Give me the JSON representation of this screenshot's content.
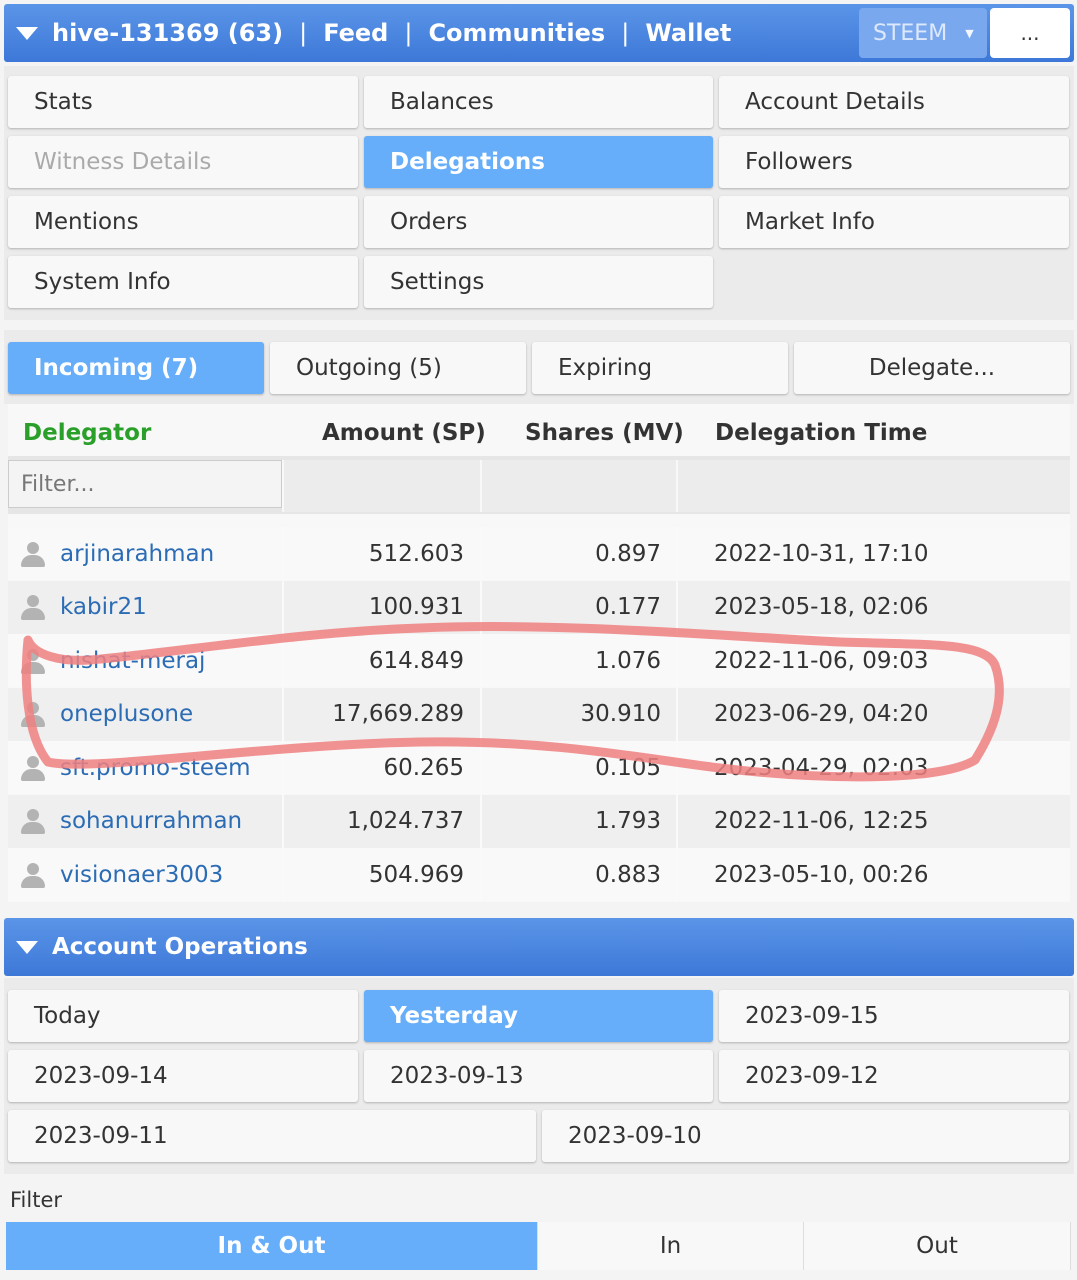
{
  "header": {
    "account": "hive-131369 (63)",
    "sep": "|",
    "links": [
      "Feed",
      "Communities",
      "Wallet"
    ],
    "chain_select": "STEEM",
    "more": "..."
  },
  "nav": {
    "items": [
      "Stats",
      "Balances",
      "Account Details",
      "Witness Details",
      "Delegations",
      "Followers",
      "Mentions",
      "Orders",
      "Market Info",
      "System Info",
      "Settings"
    ]
  },
  "tabs": [
    "Incoming (7)",
    "Outgoing (5)",
    "Expiring",
    "Delegate..."
  ],
  "table": {
    "headers": [
      "Delegator",
      "Amount (SP)",
      "Shares (MV)",
      "Delegation Time"
    ],
    "filter_placeholder": "Filter...",
    "rows": [
      {
        "name": "arjinarahman",
        "amount": "512.603",
        "shares": "0.897",
        "time": "2022-10-31, 17:10"
      },
      {
        "name": "kabir21",
        "amount": "100.931",
        "shares": "0.177",
        "time": "2023-05-18, 02:06"
      },
      {
        "name": "nishat-meraj",
        "amount": "614.849",
        "shares": "1.076",
        "time": "2022-11-06, 09:03"
      },
      {
        "name": "oneplusone",
        "amount": "17,669.289",
        "shares": "30.910",
        "time": "2023-06-29, 04:20"
      },
      {
        "name": "sft.promo-steem",
        "amount": "60.265",
        "shares": "0.105",
        "time": "2023-04-29, 02:03"
      },
      {
        "name": "sohanurrahman",
        "amount": "1,024.737",
        "shares": "1.793",
        "time": "2022-11-06, 12:25"
      },
      {
        "name": "visionaer3003",
        "amount": "504.969",
        "shares": "0.883",
        "time": "2023-05-10, 00:26"
      }
    ]
  },
  "operations": {
    "title": "Account Operations",
    "dates": [
      "Today",
      "Yesterday",
      "2023-09-15",
      "2023-09-14",
      "2023-09-13",
      "2023-09-12",
      "2023-09-11",
      "2023-09-10"
    ],
    "filter_label": "Filter",
    "filter_options": [
      "In & Out",
      "In",
      "Out"
    ]
  },
  "colors": {
    "header_blue": "#3d78d8",
    "active_blue": "#66aefa",
    "link_blue": "#2b6cb5",
    "green": "#2aa02a",
    "annotation_red": "#f08080"
  }
}
